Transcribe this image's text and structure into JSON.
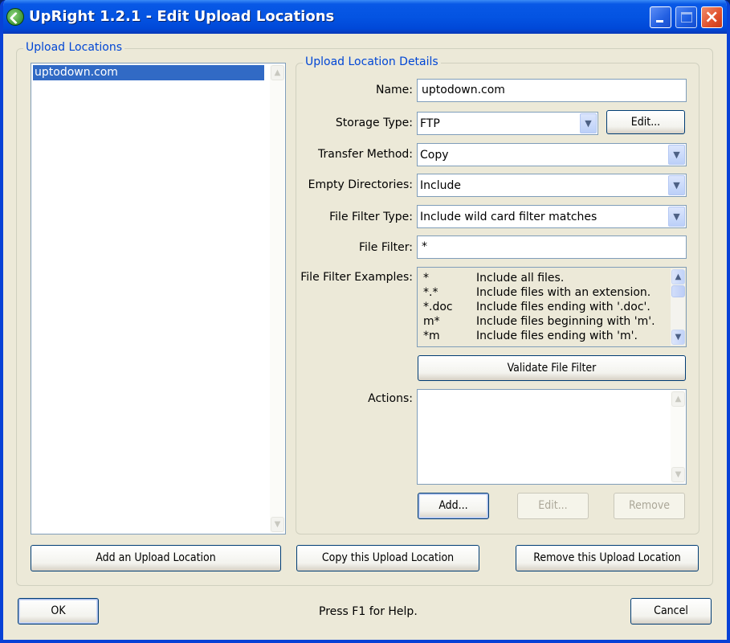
{
  "window": {
    "title": "UpRight 1.2.1 - Edit Upload Locations",
    "controls": {
      "minimize": "minimize",
      "maximize": "maximize",
      "close": "×"
    }
  },
  "upload_locations": {
    "legend": "Upload Locations",
    "items": [
      "uptodown.com"
    ],
    "selected_index": 0,
    "buttons": {
      "add": "Add an Upload Location",
      "copy": "Copy this Upload Location",
      "remove": "Remove this Upload Location"
    }
  },
  "details": {
    "legend": "Upload Location Details",
    "name": {
      "label": "Name:",
      "value": "uptodown.com"
    },
    "storage_type": {
      "label": "Storage Type:",
      "value": "FTP",
      "edit_button": "Edit..."
    },
    "transfer_method": {
      "label": "Transfer Method:",
      "value": "Copy"
    },
    "empty_directories": {
      "label": "Empty Directories:",
      "value": "Include"
    },
    "file_filter_type": {
      "label": "File Filter Type:",
      "value": "Include wild card filter matches"
    },
    "file_filter": {
      "label": "File Filter:",
      "value": "*"
    },
    "file_filter_examples": {
      "label": "File Filter Examples:",
      "rows": [
        {
          "pattern": "*",
          "description": "Include all files."
        },
        {
          "pattern": "*.*",
          "description": "Include files with an extension."
        },
        {
          "pattern": "*.doc",
          "description": "Include files ending with '.doc'."
        },
        {
          "pattern": "m*",
          "description": "Include files beginning with 'm'."
        },
        {
          "pattern": "*m",
          "description": "Include files ending with 'm'."
        }
      ]
    },
    "validate_button": "Validate File Filter",
    "actions": {
      "label": "Actions:",
      "items": [],
      "add_button": "Add...",
      "edit_button": "Edit...",
      "remove_button": "Remove"
    }
  },
  "footer": {
    "ok": "OK",
    "help": "Press F1 for Help.",
    "cancel": "Cancel"
  },
  "icons": {
    "scroll_up": "▲",
    "scroll_down": "▼",
    "dropdown": "▼"
  },
  "colors": {
    "titlebar": "#0454e2",
    "selection": "#316ac5",
    "group_legend": "#0046d5",
    "dialog_bg": "#ece9d8"
  }
}
